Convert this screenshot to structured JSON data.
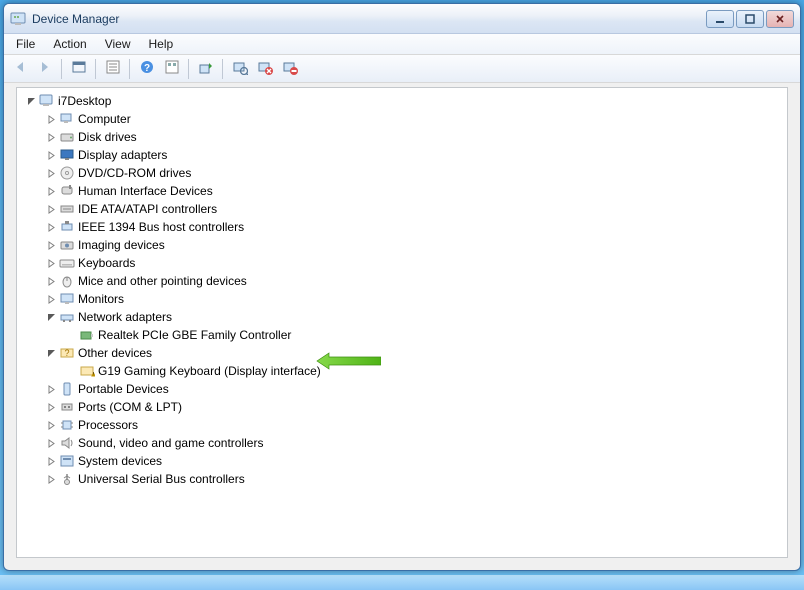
{
  "window": {
    "title": "Device Manager"
  },
  "menubar": [
    "File",
    "Action",
    "View",
    "Help"
  ],
  "toolbar": [
    {
      "name": "back-button",
      "icon": "back",
      "disabled": true
    },
    {
      "name": "forward-button",
      "icon": "forward",
      "disabled": true
    },
    {
      "sep": true
    },
    {
      "name": "show-hidden-button",
      "icon": "show-hidden"
    },
    {
      "sep": true
    },
    {
      "name": "properties-button",
      "icon": "properties"
    },
    {
      "sep": true
    },
    {
      "name": "help-button",
      "icon": "help"
    },
    {
      "name": "options-button",
      "icon": "options"
    },
    {
      "sep": true
    },
    {
      "name": "update-driver-button",
      "icon": "update-driver"
    },
    {
      "sep": true
    },
    {
      "name": "scan-hardware-button",
      "icon": "scan-hardware"
    },
    {
      "name": "uninstall-button",
      "icon": "uninstall"
    },
    {
      "name": "disable-button",
      "icon": "disable"
    }
  ],
  "tree": {
    "root": {
      "label": "i7Desktop",
      "icon": "computer",
      "expanded": true
    },
    "children": [
      {
        "label": "Computer",
        "icon": "computer-small",
        "expanded": false
      },
      {
        "label": "Disk drives",
        "icon": "disk",
        "expanded": false
      },
      {
        "label": "Display adapters",
        "icon": "display",
        "expanded": false
      },
      {
        "label": "DVD/CD-ROM drives",
        "icon": "dvd",
        "expanded": false
      },
      {
        "label": "Human Interface Devices",
        "icon": "hid",
        "expanded": false
      },
      {
        "label": "IDE ATA/ATAPI controllers",
        "icon": "ide",
        "expanded": false
      },
      {
        "label": "IEEE 1394 Bus host controllers",
        "icon": "ieee1394",
        "expanded": false
      },
      {
        "label": "Imaging devices",
        "icon": "imaging",
        "expanded": false
      },
      {
        "label": "Keyboards",
        "icon": "keyboard",
        "expanded": false
      },
      {
        "label": "Mice and other pointing devices",
        "icon": "mouse",
        "expanded": false
      },
      {
        "label": "Monitors",
        "icon": "monitor",
        "expanded": false
      },
      {
        "label": "Network adapters",
        "icon": "network",
        "expanded": true,
        "children": [
          {
            "label": "Realtek PCIe GBE Family Controller",
            "icon": "network-card",
            "highlighted": true
          }
        ]
      },
      {
        "label": "Other devices",
        "icon": "other",
        "expanded": true,
        "children": [
          {
            "label": "G19 Gaming Keyboard (Display interface)",
            "icon": "warning"
          }
        ]
      },
      {
        "label": "Portable Devices",
        "icon": "portable",
        "expanded": false
      },
      {
        "label": "Ports (COM & LPT)",
        "icon": "ports",
        "expanded": false
      },
      {
        "label": "Processors",
        "icon": "processor",
        "expanded": false
      },
      {
        "label": "Sound, video and game controllers",
        "icon": "sound",
        "expanded": false
      },
      {
        "label": "System devices",
        "icon": "system",
        "expanded": false
      },
      {
        "label": "Universal Serial Bus controllers",
        "icon": "usb",
        "expanded": false
      }
    ]
  },
  "annotation_arrow": {
    "target": "Realtek PCIe GBE Family Controller"
  }
}
